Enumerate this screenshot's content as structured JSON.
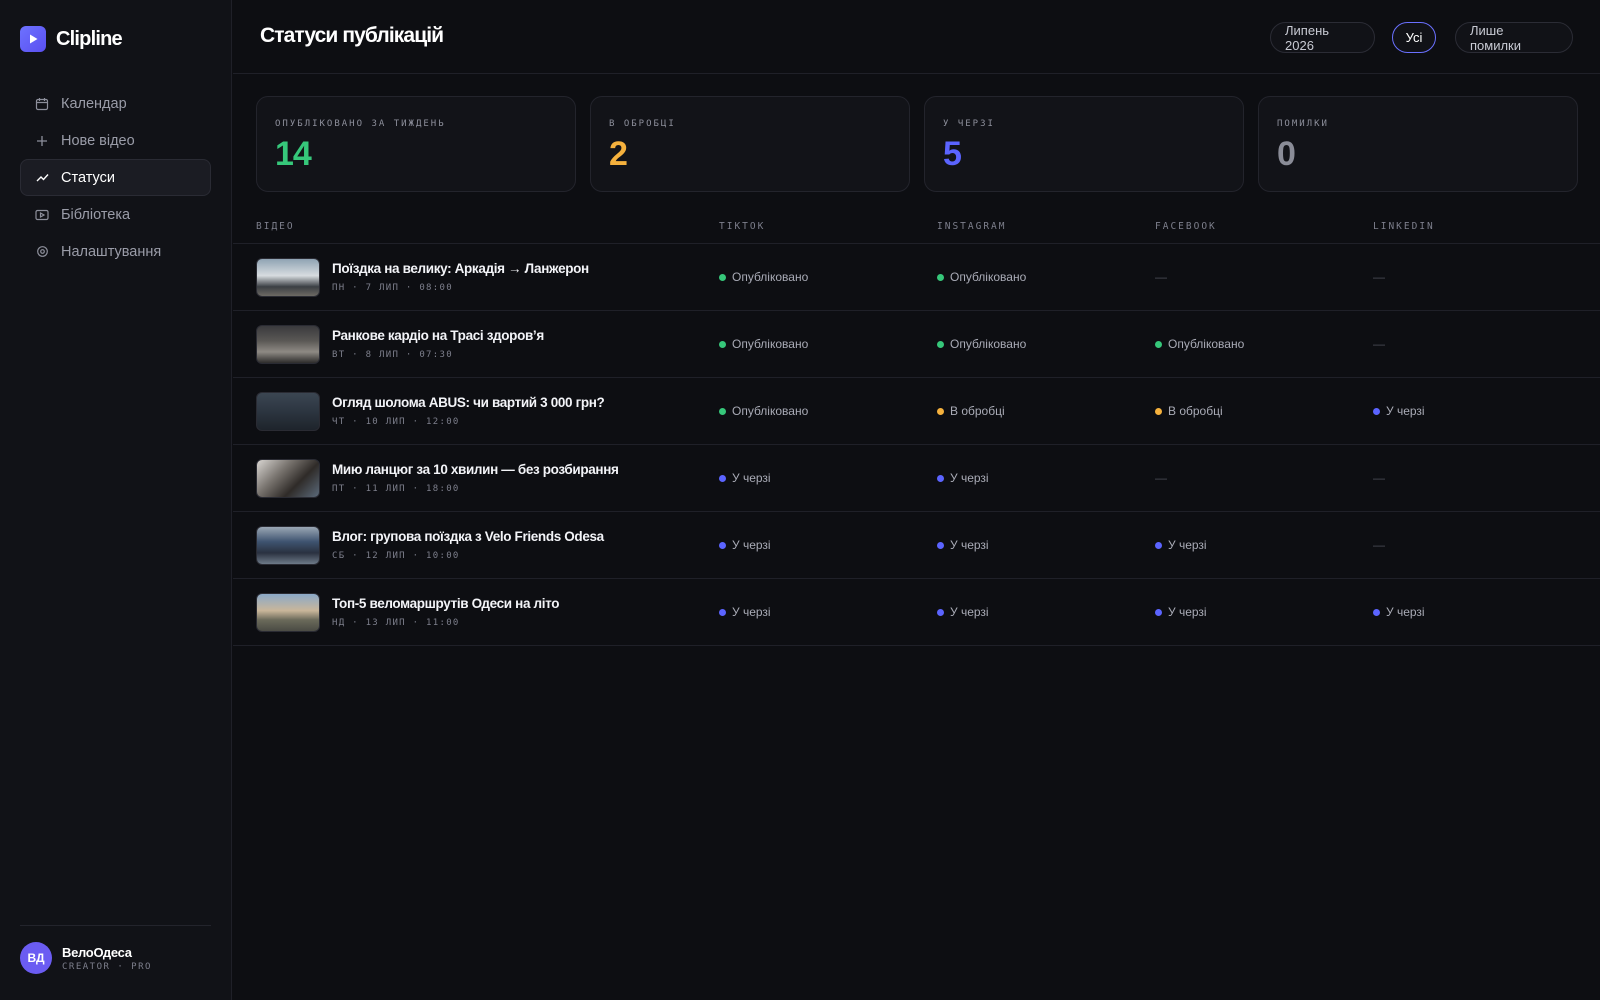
{
  "app": {
    "name": "Clipline"
  },
  "colors": {
    "published": "#36c77a",
    "processing": "#f5b13d",
    "queued": "#5b64ff",
    "errors": "#8a8c97",
    "accent": "#6a70ff"
  },
  "nav": [
    {
      "label": "Календар",
      "icon": "calendar-icon"
    },
    {
      "label": "Нове відео",
      "icon": "plus-icon"
    },
    {
      "label": "Статуси",
      "icon": "trend-icon",
      "active": true
    },
    {
      "label": "Бібліотека",
      "icon": "video-icon"
    },
    {
      "label": "Налаштування",
      "icon": "gear-icon"
    }
  ],
  "profile": {
    "initials": "ВД",
    "name": "ВелоОдеса",
    "role": "CREATOR · PRO"
  },
  "header": {
    "title": "Статуси публікацій"
  },
  "filters": {
    "month": "Липень 2026",
    "all": "Усі",
    "errors_only": "Лише помилки"
  },
  "stats": [
    {
      "label": "ОПУБЛІКОВАНО ЗА ТИЖДЕНЬ",
      "value": "14",
      "color": "#36c77a"
    },
    {
      "label": "В ОБРОБЦІ",
      "value": "2",
      "color": "#f5b13d"
    },
    {
      "label": "У ЧЕРЗІ",
      "value": "5",
      "color": "#5b64ff"
    },
    {
      "label": "ПОМИЛКИ",
      "value": "0",
      "color": "#8a8c97"
    }
  ],
  "columns": [
    "ВІДЕО",
    "TIKTOK",
    "INSTAGRAM",
    "FACEBOOK",
    "LINKEDIN"
  ],
  "status_labels": {
    "published": "Опубліковано",
    "processing": "В обробці",
    "queued": "У черзі",
    "none": "—"
  },
  "videos": [
    {
      "title": "Поїздка на велику: Аркадія → Ланжерон",
      "meta": "ПН · 7 ЛИП · 08:00",
      "statuses": [
        "published",
        "published",
        "none",
        "none"
      ]
    },
    {
      "title": "Ранкове кардіо на Трасі здоров’я",
      "meta": "ВТ · 8 ЛИП · 07:30",
      "statuses": [
        "published",
        "published",
        "published",
        "none"
      ]
    },
    {
      "title": "Огляд шолома ABUS: чи вартий 3 000 грн?",
      "meta": "ЧТ · 10 ЛИП · 12:00",
      "statuses": [
        "published",
        "processing",
        "processing",
        "queued"
      ]
    },
    {
      "title": "Мию ланцюг за 10 хвилин — без розбирання",
      "meta": "ПТ · 11 ЛИП · 18:00",
      "statuses": [
        "queued",
        "queued",
        "none",
        "none"
      ]
    },
    {
      "title": "Влог: групова поїздка з Velo Friends Odesa",
      "meta": "СБ · 12 ЛИП · 10:00",
      "statuses": [
        "queued",
        "queued",
        "queued",
        "none"
      ]
    },
    {
      "title": "Топ-5 веломаршрутів Одеси на літо",
      "meta": "НД · 13 ЛИП · 11:00",
      "statuses": [
        "queued",
        "queued",
        "queued",
        "queued"
      ]
    }
  ]
}
